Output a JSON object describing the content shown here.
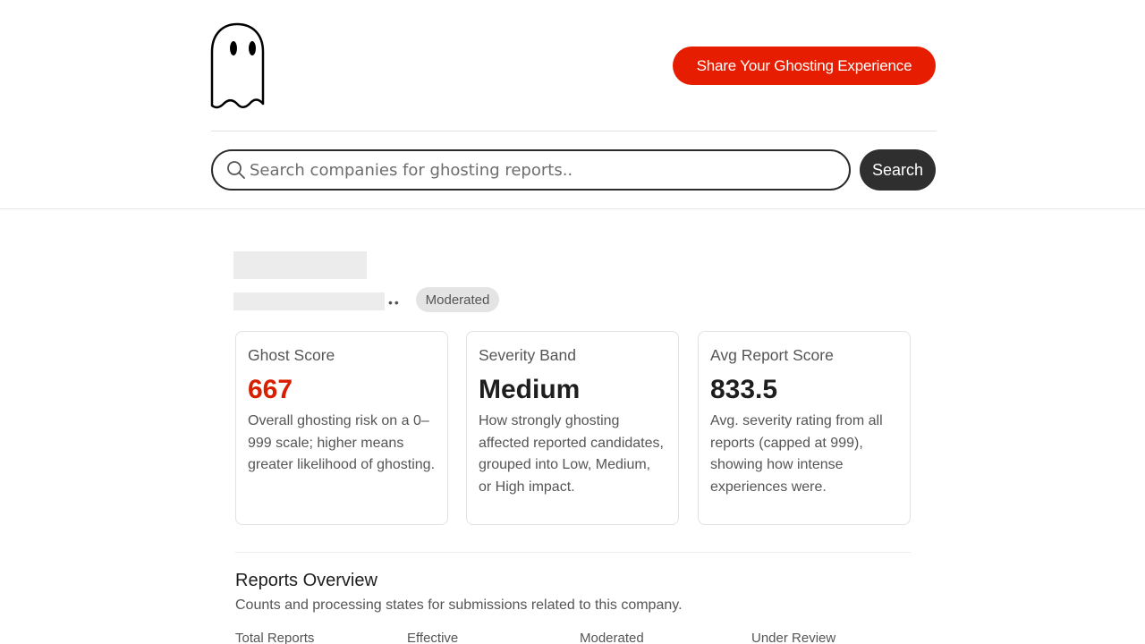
{
  "header": {
    "share_button": "Share Your Ghosting Experience",
    "search_placeholder": "Search companies for ghosting reports..",
    "search_button": "Search"
  },
  "company": {
    "dots": "••",
    "status_badge": "Moderated"
  },
  "cards": [
    {
      "label": "Ghost Score",
      "value": "667",
      "description": "Overall ghosting risk on a 0–999 scale; higher means greater likelihood of ghosting."
    },
    {
      "label": "Severity Band",
      "value": "Medium",
      "description": "How strongly ghosting affected reported candidates, grouped into Low, Medium, or High impact."
    },
    {
      "label": "Avg Report Score",
      "value": "833.5",
      "description": "Avg. severity rating from all reports (capped at 999), showing how intense experiences were."
    }
  ],
  "overview": {
    "title": "Reports Overview",
    "description": "Counts and processing states for submissions related to this company.",
    "stats": [
      "Total Reports",
      "Effective",
      "Moderated",
      "Under Review"
    ]
  },
  "colors": {
    "accent": "#e61d00",
    "score_red": "#d81f00",
    "dark_button": "#2f2f2f"
  },
  "icons": [
    "ghost-logo-icon",
    "search-icon"
  ]
}
